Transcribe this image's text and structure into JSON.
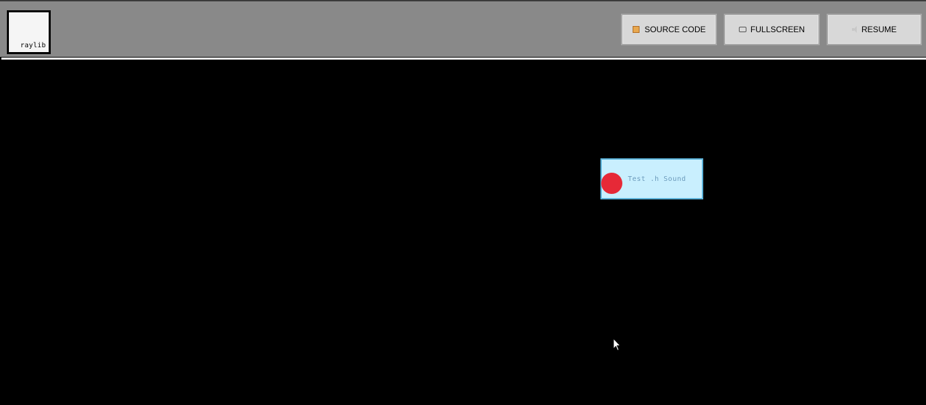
{
  "header": {
    "logo_text": "raylib",
    "buttons": {
      "source_code": {
        "label": "SOURCE CODE",
        "icon": "scroll-icon"
      },
      "fullscreen": {
        "label": "FULLSCREEN",
        "icon": "screen-icon"
      },
      "resume": {
        "label": "RESUME",
        "icon": "speaker-icon"
      }
    }
  },
  "canvas": {
    "sound_button_label": "Test .h Sound",
    "colors": {
      "background": "#000000",
      "button_fill": "#c9effe",
      "button_border": "#5bb2d9",
      "record_dot": "#e62937"
    }
  }
}
